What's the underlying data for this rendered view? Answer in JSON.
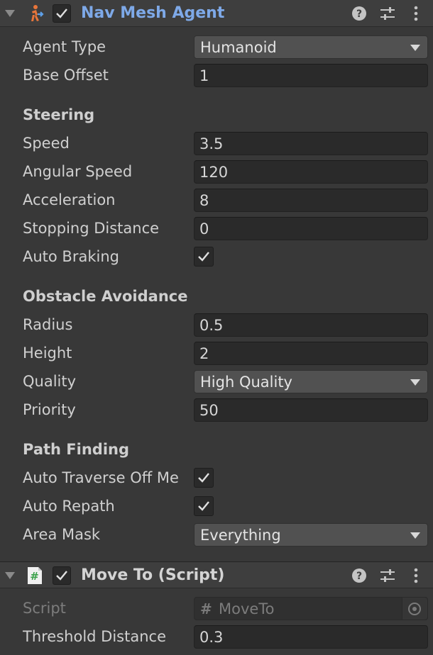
{
  "nav_mesh_agent": {
    "title": "Nav Mesh Agent",
    "enabled": true,
    "agent_type": {
      "label": "Agent Type",
      "value": "Humanoid"
    },
    "base_offset": {
      "label": "Base Offset",
      "value": "1"
    },
    "steering": {
      "heading": "Steering",
      "speed": {
        "label": "Speed",
        "value": "3.5"
      },
      "angular_speed": {
        "label": "Angular Speed",
        "value": "120"
      },
      "acceleration": {
        "label": "Acceleration",
        "value": "8"
      },
      "stopping_distance": {
        "label": "Stopping Distance",
        "value": "0"
      },
      "auto_braking": {
        "label": "Auto Braking",
        "checked": true
      }
    },
    "obstacle_avoidance": {
      "heading": "Obstacle Avoidance",
      "radius": {
        "label": "Radius",
        "value": "0.5"
      },
      "height": {
        "label": "Height",
        "value": "2"
      },
      "quality": {
        "label": "Quality",
        "value": "High Quality"
      },
      "priority": {
        "label": "Priority",
        "value": "50"
      }
    },
    "path_finding": {
      "heading": "Path Finding",
      "auto_traverse": {
        "label": "Auto Traverse Off Me",
        "checked": true
      },
      "auto_repath": {
        "label": "Auto Repath",
        "checked": true
      },
      "area_mask": {
        "label": "Area Mask",
        "value": "Everything"
      }
    }
  },
  "move_to_script": {
    "title": "Move To (Script)",
    "enabled": true,
    "script": {
      "label": "Script",
      "value": "MoveTo"
    },
    "threshold_distance": {
      "label": "Threshold Distance",
      "value": "0.3"
    }
  },
  "colors": {
    "background": "#383838",
    "header": "#3e3e3e",
    "field": "#2a2a2a",
    "title_accent": "#7ea9e8",
    "agent_icon": "#e8753a",
    "script_icon": "#4caf50"
  },
  "icons": {
    "fold": "triangle-down-icon",
    "agent": "nav-mesh-agent-icon",
    "script": "csharp-script-icon",
    "help": "help-icon",
    "preset": "preset-sliders-icon",
    "menu": "kebab-menu-icon",
    "dropdown": "dropdown-arrow-icon",
    "check": "checkmark-icon",
    "picker": "object-picker-icon"
  }
}
